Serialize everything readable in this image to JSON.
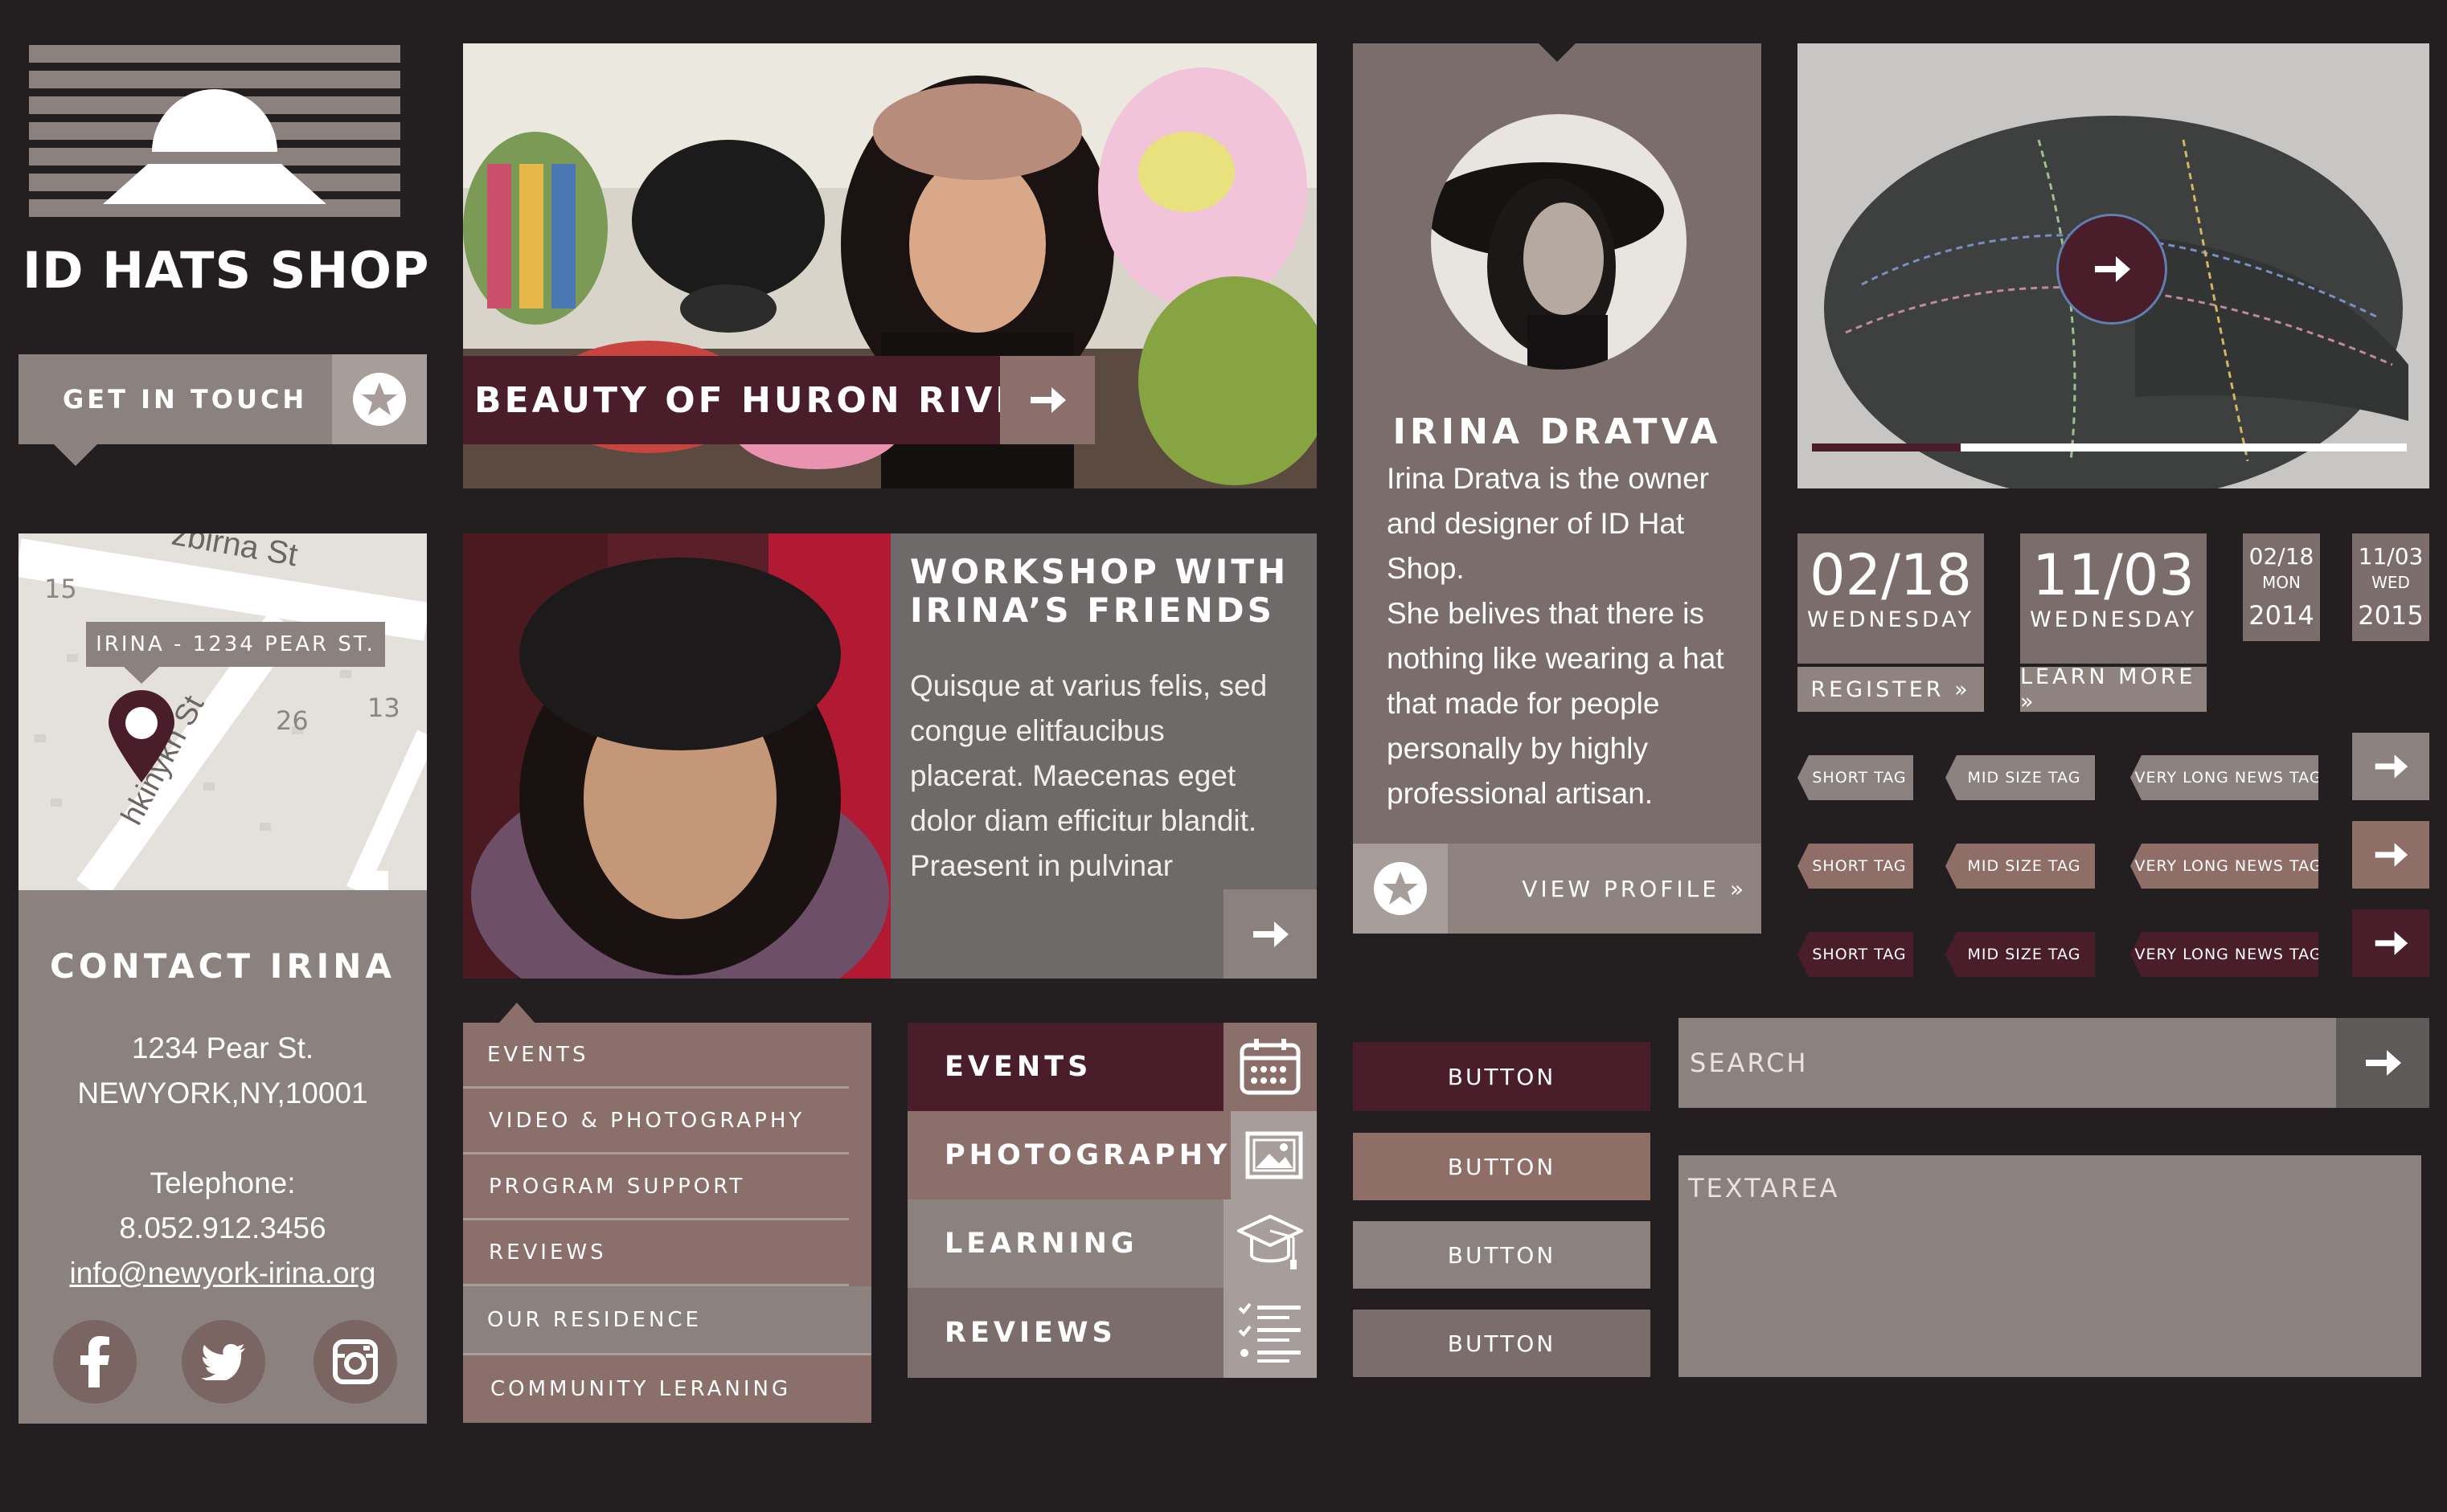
{
  "brand": {
    "name": "ID HATS SHOP",
    "logo_icon": "hat-logo-icon"
  },
  "cta": {
    "get_in_touch": "GET IN TOUCH",
    "icon": "star-icon"
  },
  "hero": {
    "label": "BEAUTY OF HURON RIVER",
    "icon": "arrow-right-icon"
  },
  "workshop": {
    "title_line1": "WORKSHOP WITH",
    "title_line2": "IRINA’S FRIENDS",
    "body": [
      "Quisque at varius felis, sed",
      "congue elitfaucibus",
      "placerat. Maecenas eget",
      "dolor diam efficitur blandit.",
      "Praesent in pulvinar"
    ]
  },
  "profile": {
    "name": "IRINA DRATVA",
    "bio": [
      "Irina Dratva is the owner",
      "and designer of ID Hat",
      "Shop.",
      "She belives that there is",
      "nothing like wearing a hat",
      "that made for people",
      "personally by highly",
      "professional artisan."
    ],
    "view_profile": "VIEW  PROFILE »"
  },
  "slider": {
    "progress": 0.25
  },
  "dates": [
    {
      "date": "02/18",
      "day": "WEDNESDAY",
      "action": "REGISTER »"
    },
    {
      "date": "11/03",
      "day": "WEDNESDAY",
      "action": "LEARN MORE »"
    }
  ],
  "mini_dates": [
    {
      "date": "02/18",
      "day": "MON",
      "year": "2014"
    },
    {
      "date": "11/03",
      "day": "WED",
      "year": "2015"
    }
  ],
  "tags": {
    "short": "SHORT TAG",
    "mid": "MID SIZE TAG",
    "long": "VERY LONG NEWS TAG"
  },
  "map": {
    "street1": "zbirna St",
    "street2": "hkinykh St",
    "num15": "15",
    "num26": "26",
    "num13": "13",
    "label": "IRINA - 1234 PEAR ST."
  },
  "contact": {
    "title": "CONTACT IRINA",
    "address1": "1234 Pear St.",
    "address2": "NEWYORK,NY,10001",
    "phone_label": "Telephone:",
    "phone": "8.052.912.3456",
    "email": "info@newyork-irina.org"
  },
  "menu": [
    "EVENTS",
    "VIDEO & PHOTOGRAPHY",
    "PROGRAM SUPPORT",
    "REVIEWS",
    "OUR RESIDENCE",
    "COMMUNITY LERANING"
  ],
  "categories": [
    {
      "label": "EVENTS",
      "icon": "calendar-icon"
    },
    {
      "label": "PHOTOGRAPHY",
      "icon": "image-icon"
    },
    {
      "label": "LEARNING",
      "icon": "graduation-cap-icon"
    },
    {
      "label": "REVIEWS",
      "icon": "list-icon"
    }
  ],
  "buttons": [
    "BUTTON",
    "BUTTON",
    "BUTTON",
    "BUTTON"
  ],
  "search": {
    "placeholder": "SEARCH"
  },
  "textarea": {
    "placeholder": "TEXTAREA"
  },
  "colors": {
    "background": "#231f20",
    "burgundy": "#4a1d2b",
    "taupe": "#8b817f",
    "rose_brown": "#8f6e68",
    "gray": "#6e6a6a"
  }
}
